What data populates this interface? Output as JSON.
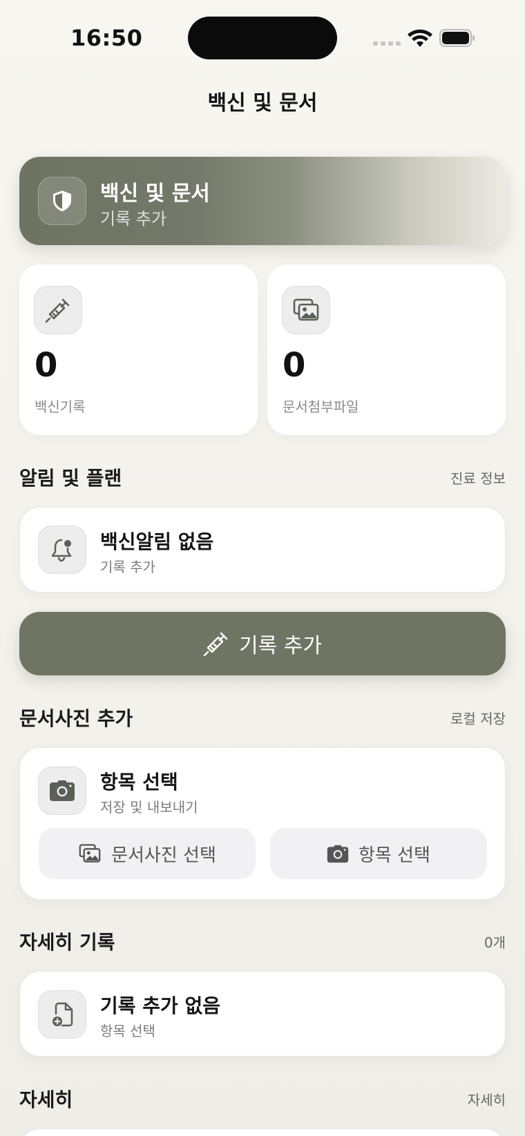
{
  "status_bar": {
    "time": "16:50"
  },
  "nav": {
    "title": "백신 및 문서"
  },
  "hero": {
    "title": "백신 및 문서",
    "subtitle": "기록 추가",
    "icon": "shield-icon"
  },
  "stats": [
    {
      "icon": "syringe-icon",
      "value": "0",
      "label": "백신기록"
    },
    {
      "icon": "photos-icon",
      "value": "0",
      "label": "문서첨부파일"
    }
  ],
  "alerts_section": {
    "title": "알림 및 플랜",
    "right": "진료 정보",
    "card": {
      "icon": "bell-icon",
      "title": "백신알림 없음",
      "subtitle": "기록 추가"
    }
  },
  "primary_button": {
    "icon": "syringe-icon",
    "label": "기록 추가"
  },
  "photo_section": {
    "title": "문서사진 추가",
    "right": "로컬 저장",
    "card": {
      "icon": "camera-icon",
      "title": "항목 선택",
      "subtitle": "저장 및 내보내기",
      "buttons": [
        {
          "icon": "photos-icon",
          "label": "문서사진 선택"
        },
        {
          "icon": "camera-icon",
          "label": "항목 선택"
        }
      ]
    }
  },
  "records_section": {
    "title": "자세히 기록",
    "right": "0개",
    "card": {
      "icon": "document-add-icon",
      "title": "기록 추가 없음",
      "subtitle": "항목 선택"
    }
  },
  "details_section": {
    "title": "자세히",
    "right": "자세히"
  },
  "colors": {
    "accent": "#6e7563",
    "background": "#f5f4ef"
  }
}
